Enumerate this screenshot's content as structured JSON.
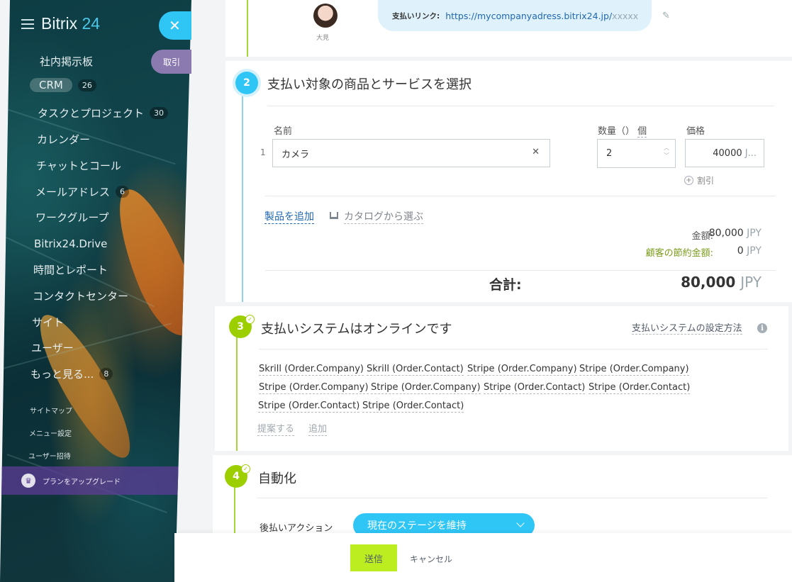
{
  "sidebar": {
    "logo_main": "Bitrix",
    "logo_num": " 24",
    "close_symbol": "✕",
    "side_tab": "取引",
    "items": [
      {
        "label": "社内掲示板",
        "badge": ""
      },
      {
        "label": "CRM",
        "badge": "26"
      },
      {
        "label": "タスクとプロジェクト",
        "badge": "30"
      },
      {
        "label": "カレンダー",
        "badge": ""
      },
      {
        "label": "チャットとコール",
        "badge": ""
      },
      {
        "label": "メールアドレス",
        "badge": "6"
      },
      {
        "label": "ワークグループ",
        "badge": ""
      },
      {
        "label": "Bitrix24.Drive",
        "badge": ""
      },
      {
        "label": "時間とレポート",
        "badge": ""
      },
      {
        "label": "コンタクトセンター",
        "badge": ""
      },
      {
        "label": "サイト",
        "badge": ""
      },
      {
        "label": "ユーザー",
        "badge": ""
      },
      {
        "label": "もっと見る...",
        "badge": "8"
      }
    ],
    "small_links": [
      "サイトマップ",
      "メニュー設定",
      "ユーザー招待"
    ],
    "upgrade": "プランをアップグレード",
    "icons": {
      "menu": "hamburger-icon",
      "upgrade": "crown-icon"
    }
  },
  "message": {
    "avatar_name": "大見",
    "link_label": "支払いリンク:",
    "link_url": "https://mycompanyadress.bitrix24.jp/",
    "link_suffix": "xxxxx"
  },
  "step2": {
    "number": "2",
    "title": "支払い対象の商品とサービスを選択",
    "col_name": "名前",
    "col_qty": "数量（）",
    "col_unit": "個",
    "col_price": "価格",
    "rows": [
      {
        "num": "1",
        "name": "カメラ",
        "qty": "2",
        "price": "40000",
        "price_cur": "J..."
      }
    ],
    "discount": "割引",
    "add_product": "製品を追加",
    "from_catalog": "カタログから選ぶ",
    "amount_label": "金額:",
    "amount_value": "80,000",
    "savings_label": "顧客の節約金額:",
    "savings_value": "0",
    "total_label": "合計:",
    "total_value": "80,000",
    "currency": "JPY"
  },
  "step3": {
    "number": "3",
    "title": "支払いシステムはオンラインです",
    "howto": "支払いシステムの設定方法",
    "systems": [
      "Skrill (Order.Company)",
      "Skrill (Order.Contact)",
      "Stripe (Order.Company)",
      "Stripe (Order.Company)",
      "Stripe (Order.Company)",
      "Stripe (Order.Company)",
      "Stripe (Order.Contact)",
      "Stripe (Order.Contact)",
      "Stripe (Order.Contact)",
      "Stripe (Order.Contact)"
    ],
    "suggest": "提案する",
    "add": "追加"
  },
  "step4": {
    "number": "4",
    "title": "自動化",
    "action_label": "後払いアクション",
    "action_value": "現在のステージを維持"
  },
  "footer": {
    "send": "送信",
    "cancel": "キャンセル"
  },
  "colors": {
    "accent_blue": "#2fc6f6",
    "accent_green": "#9dcf00",
    "send_button": "#bbed21",
    "link": "#2067b0"
  }
}
